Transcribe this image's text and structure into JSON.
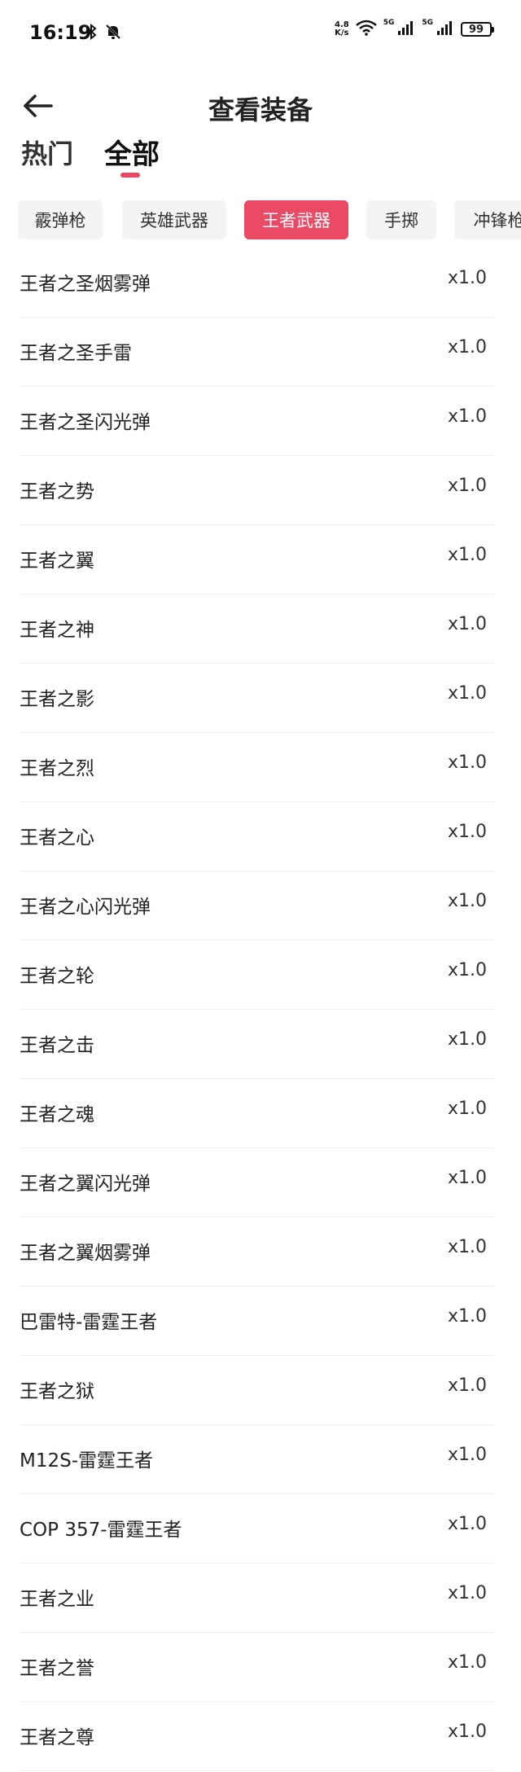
{
  "status_bar": {
    "time": "16:19",
    "net_speed_value": "4.8",
    "net_speed_unit": "K/s",
    "signal1_label": "5G",
    "signal2_label": "5G",
    "battery": "99"
  },
  "header": {
    "title": "查看装备"
  },
  "tabs": {
    "hot": "热门",
    "all": "全部"
  },
  "chips": [
    {
      "label": "霰弹枪"
    },
    {
      "label": "英雄武器"
    },
    {
      "label": "王者武器"
    },
    {
      "label": "手掷"
    },
    {
      "label": "冲锋枪"
    }
  ],
  "items": [
    {
      "name": "王者之圣烟雾弹",
      "multiplier": "x1.0"
    },
    {
      "name": "王者之圣手雷",
      "multiplier": "x1.0"
    },
    {
      "name": "王者之圣闪光弹",
      "multiplier": "x1.0"
    },
    {
      "name": "王者之势",
      "multiplier": "x1.0"
    },
    {
      "name": "王者之翼",
      "multiplier": "x1.0"
    },
    {
      "name": "王者之神",
      "multiplier": "x1.0"
    },
    {
      "name": "王者之影",
      "multiplier": "x1.0"
    },
    {
      "name": "王者之烈",
      "multiplier": "x1.0"
    },
    {
      "name": "王者之心",
      "multiplier": "x1.0"
    },
    {
      "name": "王者之心闪光弹",
      "multiplier": "x1.0"
    },
    {
      "name": "王者之轮",
      "multiplier": "x1.0"
    },
    {
      "name": "王者之击",
      "multiplier": "x1.0"
    },
    {
      "name": "王者之魂",
      "multiplier": "x1.0"
    },
    {
      "name": "王者之翼闪光弹",
      "multiplier": "x1.0"
    },
    {
      "name": "王者之翼烟雾弹",
      "multiplier": "x1.0"
    },
    {
      "name": "巴雷特-雷霆王者",
      "multiplier": "x1.0"
    },
    {
      "name": "王者之狱",
      "multiplier": "x1.0"
    },
    {
      "name": "M12S-雷霆王者",
      "multiplier": "x1.0"
    },
    {
      "name": "COP 357-雷霆王者",
      "multiplier": "x1.0"
    },
    {
      "name": "王者之业",
      "multiplier": "x1.0"
    },
    {
      "name": "王者之誉",
      "multiplier": "x1.0"
    },
    {
      "name": "王者之尊",
      "multiplier": "x1.0"
    }
  ]
}
